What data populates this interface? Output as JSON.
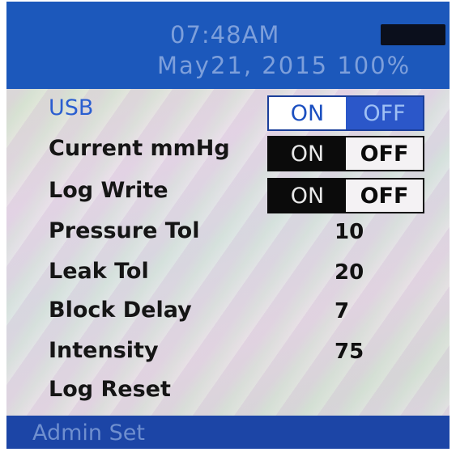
{
  "status": {
    "time": "07:48AM",
    "date": "May21, 2015",
    "battery_percent": "100%"
  },
  "menu": {
    "usb": {
      "label": "USB",
      "on": "ON",
      "off": "OFF",
      "state": "off"
    },
    "current_mmhg": {
      "label": "Current mmHg",
      "on": "ON",
      "off": "OFF",
      "state": "on"
    },
    "log_write": {
      "label": "Log Write",
      "on": "ON",
      "off": "OFF",
      "state": "on"
    },
    "pressure_tol": {
      "label": "Pressure Tol",
      "value": "10"
    },
    "leak_tol": {
      "label": "Leak Tol",
      "value": "20"
    },
    "block_delay": {
      "label": "Block Delay",
      "value": "7"
    },
    "intensity": {
      "label": "Intensity",
      "value": "75"
    },
    "log_reset": {
      "label": "Log Reset"
    }
  },
  "footer": {
    "title": "Admin Set"
  },
  "colors": {
    "header": "#1c58bb",
    "footer": "#1c45a6",
    "selected_label": "#2a5ed0",
    "toggle_dark": "#0b0b0b"
  }
}
